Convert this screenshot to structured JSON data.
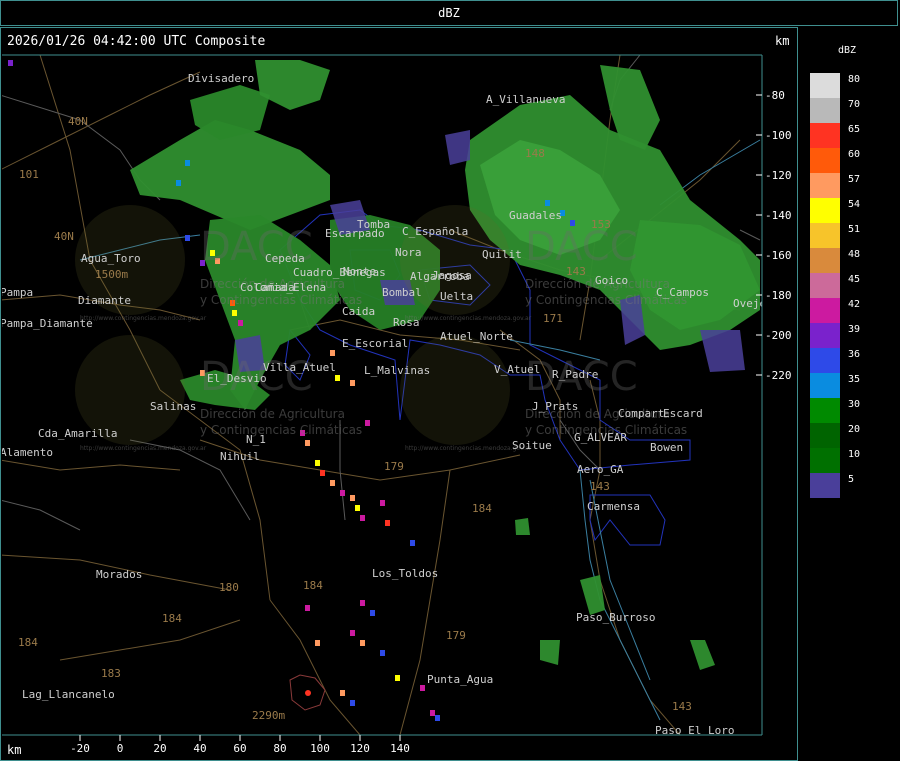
{
  "title": "dBZ",
  "timestamp": "2026/01/26 04:42:00 UTC Composite",
  "km_top": "km",
  "km_bottom": "km",
  "x_ticks": [
    "-20",
    "0",
    "20",
    "40",
    "60",
    "80",
    "100",
    "120",
    "140"
  ],
  "y_ticks": [
    "-80",
    "-100",
    "-120",
    "-140",
    "-160",
    "-180",
    "-200",
    "-220"
  ],
  "legend": {
    "title": "dBZ",
    "items": [
      {
        "label": "80",
        "color": "#dcdcdc"
      },
      {
        "label": "70",
        "color": "#b9b9b9"
      },
      {
        "label": "65",
        "color": "#ff3322"
      },
      {
        "label": "60",
        "color": "#ff5a0a"
      },
      {
        "label": "57",
        "color": "#ff9a60"
      },
      {
        "label": "54",
        "color": "#ffff00"
      },
      {
        "label": "51",
        "color": "#f7c42a"
      },
      {
        "label": "48",
        "color": "#d98a3c"
      },
      {
        "label": "45",
        "color": "#cc6a9a"
      },
      {
        "label": "42",
        "color": "#cc1aa0"
      },
      {
        "label": "39",
        "color": "#7a22cc"
      },
      {
        "label": "36",
        "color": "#2e4ae8"
      },
      {
        "label": "35",
        "color": "#0a8ce0"
      },
      {
        "label": "30",
        "color": "#008a00"
      },
      {
        "label": "20",
        "color": "#006400"
      },
      {
        "label": "10",
        "color": "#007000"
      },
      {
        "label": "5",
        "color": "#4a3f9a"
      }
    ]
  },
  "places": [
    {
      "name": "Divisadero"
    },
    {
      "name": "A_Villanueva"
    },
    {
      "name": "Guadales"
    },
    {
      "name": "Agua_Toro"
    },
    {
      "name": "Tomba"
    },
    {
      "name": "C_Española"
    },
    {
      "name": "Nora"
    },
    {
      "name": "Algarroba"
    },
    {
      "name": "Bombal"
    },
    {
      "name": "Rosa"
    },
    {
      "name": "Caida"
    },
    {
      "name": "E_Escorial"
    },
    {
      "name": "L_Malvinas"
    },
    {
      "name": "Atuel_Norte"
    },
    {
      "name": "V_Atuel"
    },
    {
      "name": "R_Padre"
    },
    {
      "name": "J_Prats"
    },
    {
      "name": "Compart"
    },
    {
      "name": "Escard"
    },
    {
      "name": "G_ALVEAR"
    },
    {
      "name": "Bowen"
    },
    {
      "name": "Soitue"
    },
    {
      "name": "Aero_GA"
    },
    {
      "name": "Carmensa"
    },
    {
      "name": "Goico"
    },
    {
      "name": "C_Campos"
    },
    {
      "name": "Ovejero"
    },
    {
      "name": "Pampa_Diamante"
    },
    {
      "name": "El_Desvio"
    },
    {
      "name": "Salinas"
    },
    {
      "name": "Cda_Amarilla"
    },
    {
      "name": "N_1"
    },
    {
      "name": "Nihuil"
    },
    {
      "name": "Morados"
    },
    {
      "name": "Los_Toldos"
    },
    {
      "name": "Paso_Burroso"
    },
    {
      "name": "Punta_Agua"
    },
    {
      "name": "Lag_Llancanelo"
    },
    {
      "name": "Paso_El_Loro"
    },
    {
      "name": "Cuadro_Benegas"
    },
    {
      "name": "Villa_Atuel"
    },
    {
      "name": "Colonia_Elena"
    },
    {
      "name": "Cepeda"
    },
    {
      "name": "Diamante"
    },
    {
      "name": "Quilit"
    },
    {
      "name": "Monte"
    },
    {
      "name": "Pampa"
    },
    {
      "name": "Escarpado"
    },
    {
      "name": "Jagosa"
    },
    {
      "name": "Cañada"
    },
    {
      "name": "Alamento"
    },
    {
      "name": "Uelta"
    }
  ],
  "road_labels": [
    "40N",
    "40N",
    "101",
    "184",
    "179",
    "180",
    "184",
    "184",
    "183",
    "184",
    "179",
    "143",
    "143",
    "171",
    "143",
    "148",
    "153"
  ],
  "elevation_labels": [
    "1500m",
    "2290m"
  ],
  "watermark": {
    "logo": "DACC",
    "line1": "Dirección de Agricultura",
    "line2": "y Contingencias Climáticas",
    "url": "http://www.contingencias.mendoza.gov.ar"
  },
  "colors": {
    "frame": "#3f8f8f",
    "echo_light": "#2f8f2f",
    "echo_dark": "#0f6a0f"
  }
}
